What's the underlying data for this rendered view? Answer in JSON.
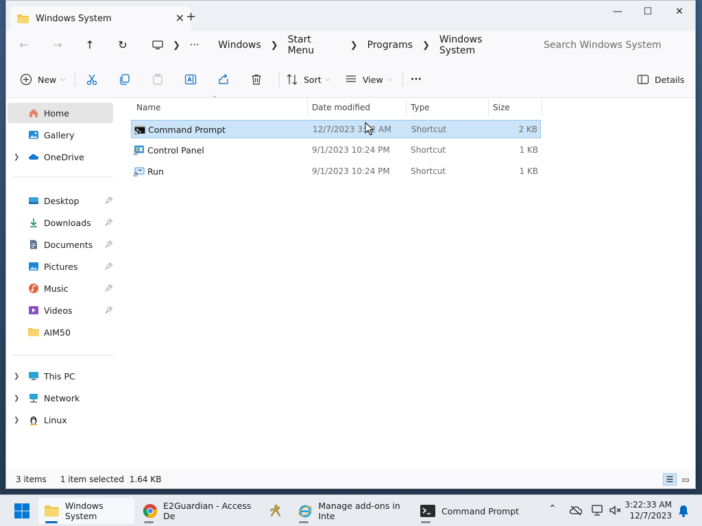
{
  "window": {
    "tab_title": "Windows System",
    "tab_close": "✕",
    "new_tab": "+",
    "minimize": "—",
    "maximize": "☐",
    "close": "✕"
  },
  "address": {
    "back": "←",
    "forward": "→",
    "up": "↑",
    "refresh": "↻",
    "ellipsis": "···",
    "breadcrumb": [
      "Windows",
      "Start Menu",
      "Programs",
      "Windows System"
    ],
    "search_placeholder": "Search Windows System"
  },
  "toolbar": {
    "new_label": "New",
    "sort_label": "Sort",
    "view_label": "View",
    "more_label": "···",
    "details_label": "Details"
  },
  "sidebar": {
    "home": "Home",
    "gallery": "Gallery",
    "onedrive": "OneDrive",
    "quick": [
      {
        "label": "Desktop"
      },
      {
        "label": "Downloads"
      },
      {
        "label": "Documents"
      },
      {
        "label": "Pictures"
      },
      {
        "label": "Music"
      },
      {
        "label": "Videos"
      },
      {
        "label": "AIM50"
      }
    ],
    "this_pc": "This PC",
    "network": "Network",
    "linux": "Linux"
  },
  "columns": {
    "name": "Name",
    "date": "Date modified",
    "type": "Type",
    "size": "Size"
  },
  "files": [
    {
      "name": "Command Prompt",
      "date": "12/7/2023 3:22 AM",
      "type": "Shortcut",
      "size": "2 KB",
      "selected": true
    },
    {
      "name": "Control Panel",
      "date": "9/1/2023 10:24 PM",
      "type": "Shortcut",
      "size": "1 KB",
      "selected": false
    },
    {
      "name": "Run",
      "date": "9/1/2023 10:24 PM",
      "type": "Shortcut",
      "size": "1 KB",
      "selected": false
    }
  ],
  "status": {
    "count": "3 items",
    "selection": "1 item selected",
    "selected_size": "1.64 KB"
  },
  "taskbar": {
    "apps": [
      {
        "label": "Windows System"
      },
      {
        "label": "E2Guardian - Access De"
      },
      {
        "label": "Manage add-ons in Inte"
      },
      {
        "label": "Command Prompt"
      }
    ],
    "time": "3:22:33 AM",
    "date": "12/7/2023"
  },
  "colors": {
    "accent": "#0067c0",
    "selection": "#cce4f7",
    "folder": "#f2c94c"
  }
}
